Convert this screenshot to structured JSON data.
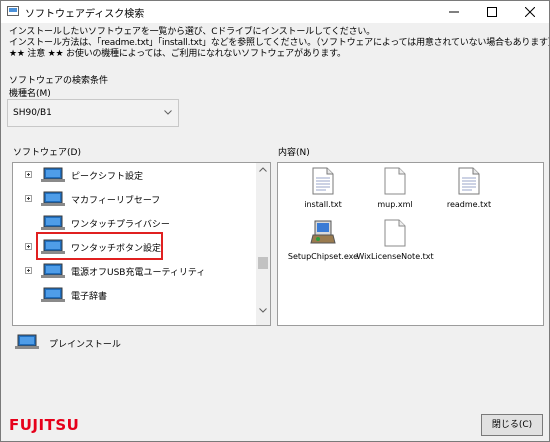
{
  "window": {
    "title": "ソフトウェアディスク検索",
    "minimize_icon": "minimize-icon",
    "maximize_icon": "maximize-icon",
    "close_icon": "close-icon"
  },
  "instructions": [
    "インストールしたいソフトウェアを一覧から選び、Cドライブにインストールしてください。",
    "インストール方法は、「readme.txt」「install.txt」などを参照してください。（ソフトウェアによっては用意されていない場合もあります）",
    "★★ 注意 ★★ お使いの機種によっては、ご利用になれないソフトウェアがあります。"
  ],
  "search": {
    "section_label": "ソフトウェアの検索条件",
    "model_label": "機種名(M)",
    "model_value": "SH90/B1"
  },
  "software": {
    "label": "ソフトウェア(D)",
    "items": [
      {
        "label": "ピークシフト設定",
        "expandable": true
      },
      {
        "label": "マカフィーリブセーフ",
        "expandable": true
      },
      {
        "label": "ワンタッチプライバシー",
        "expandable": false
      },
      {
        "label": "ワンタッチボタン設定",
        "expandable": true,
        "highlighted": true
      },
      {
        "label": "電源オフUSB充電ユーティリティ",
        "expandable": true
      },
      {
        "label": "電子辞書",
        "expandable": false
      }
    ]
  },
  "contents": {
    "label": "内容(N)",
    "files": [
      {
        "name": "install.txt",
        "icon": "text-file-icon"
      },
      {
        "name": "mup.xml",
        "icon": "document-icon"
      },
      {
        "name": "readme.txt",
        "icon": "text-file-icon"
      },
      {
        "name": "SetupChipset.exe",
        "icon": "installer-icon"
      },
      {
        "name": "WixLicenseNote.txt",
        "icon": "document-icon"
      }
    ]
  },
  "preinstall_label": "プレインストール",
  "footer": {
    "brand": "FUJITSU",
    "close_label": "閉じる(C)"
  },
  "colors": {
    "highlight_border": "#e02020",
    "brand_red": "#e6001a",
    "laptop_screen": "#1f6fc0"
  }
}
